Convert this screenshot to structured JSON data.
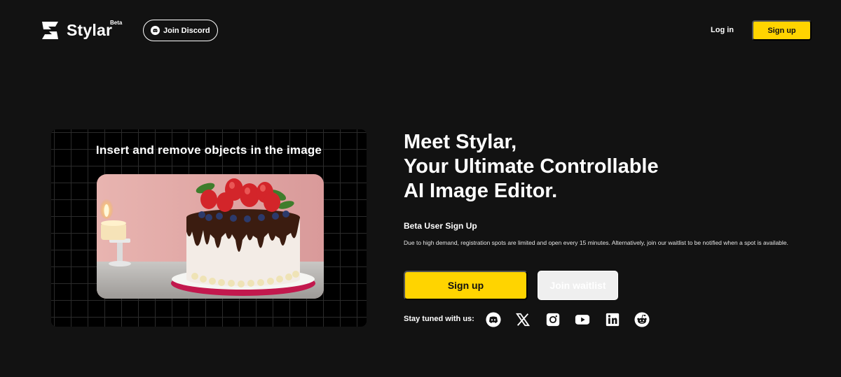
{
  "header": {
    "brand": "Stylar",
    "beta_badge": "Beta",
    "discord_label": "Join Discord",
    "login_label": "Log in",
    "signup_label": "Sign up"
  },
  "demo": {
    "title": "Insert and remove objects in the image"
  },
  "hero": {
    "title_lines": [
      "Meet Stylar,",
      "Your Ultimate Controllable",
      "AI Image Editor."
    ],
    "beta_heading": "Beta User Sign Up",
    "beta_description": "Due to high demand, registration spots are limited and open every 15 minutes. Alternatively, join our waitlist to be notified when a spot is available.",
    "signup_label": "Sign up",
    "waitlist_label": "Join waitlist",
    "stay_tuned": "Stay tuned with us:"
  },
  "social": [
    "discord-icon",
    "x-icon",
    "instagram-icon",
    "youtube-icon",
    "linkedin-icon",
    "reddit-icon"
  ],
  "colors": {
    "background": "#121212",
    "accent": "#ffd400",
    "text": "#ffffff"
  }
}
